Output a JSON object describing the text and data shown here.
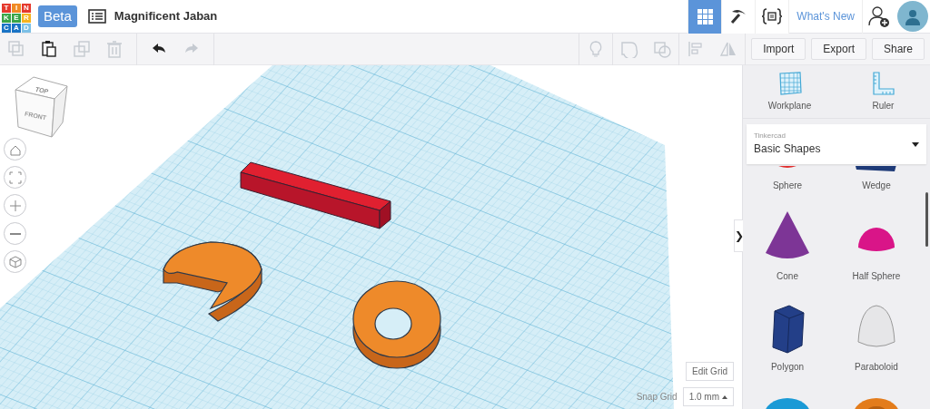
{
  "header": {
    "logo": [
      {
        "letter": "T",
        "color": "#e5392d"
      },
      {
        "letter": "I",
        "color": "#f08a24"
      },
      {
        "letter": "N",
        "color": "#e5392d"
      },
      {
        "letter": "K",
        "color": "#3aa548"
      },
      {
        "letter": "E",
        "color": "#3aa548"
      },
      {
        "letter": "R",
        "color": "#f5b320"
      },
      {
        "letter": "C",
        "color": "#1b74c5"
      },
      {
        "letter": "A",
        "color": "#1b74c5"
      },
      {
        "letter": "D",
        "color": "#7cc0e6"
      }
    ],
    "badge": "Beta",
    "title": "Magnificent Jaban",
    "nav": [
      {
        "kind": "grid",
        "selected": true
      },
      {
        "kind": "pickaxe",
        "selected": false
      },
      {
        "kind": "code",
        "selected": false
      }
    ],
    "whats_new": "What's New"
  },
  "toolbar": {
    "tools": [
      {
        "kind": "copy",
        "disabled": true
      },
      {
        "kind": "paste",
        "disabled": false
      },
      {
        "kind": "duplicate",
        "disabled": true
      },
      {
        "kind": "delete",
        "disabled": true
      },
      {
        "kind": "undo",
        "disabled": false
      },
      {
        "kind": "redo",
        "disabled": true
      }
    ],
    "view_tools": [
      {
        "kind": "bulb",
        "disabled": true
      },
      {
        "kind": "solid",
        "disabled": true
      },
      {
        "kind": "hole",
        "disabled": true
      },
      {
        "kind": "align",
        "disabled": true
      },
      {
        "kind": "mirror",
        "disabled": true
      }
    ],
    "buttons": [
      "Import",
      "Export",
      "Share"
    ]
  },
  "view_cube": {
    "top": "TOP",
    "front": "FRONT"
  },
  "view_controls": [
    {
      "kind": "home"
    },
    {
      "kind": "fit"
    },
    {
      "kind": "zoom_in"
    },
    {
      "kind": "zoom_out"
    },
    {
      "kind": "perspective"
    }
  ],
  "grid": {
    "edit": "Edit Grid",
    "snap_label": "Snap Grid",
    "snap_value": "1.0 mm"
  },
  "sidebar": {
    "toggle": "❯",
    "tools": [
      {
        "kind": "workplane",
        "label": "Workplane"
      },
      {
        "kind": "ruler",
        "label": "Ruler"
      }
    ],
    "library": {
      "caption": "Tinkercad",
      "value": "Basic Shapes"
    },
    "shapes": [
      {
        "kind": "sphere",
        "label": "Sphere"
      },
      {
        "kind": "wedge",
        "label": "Wedge"
      },
      {
        "kind": "cone",
        "label": "Cone"
      },
      {
        "kind": "half_sphere",
        "label": "Half Sphere"
      },
      {
        "kind": "polygon",
        "label": "Polygon"
      },
      {
        "kind": "paraboloid",
        "label": "Paraboloid"
      },
      {
        "kind": "torus"
      },
      {
        "kind": "tube"
      }
    ]
  }
}
